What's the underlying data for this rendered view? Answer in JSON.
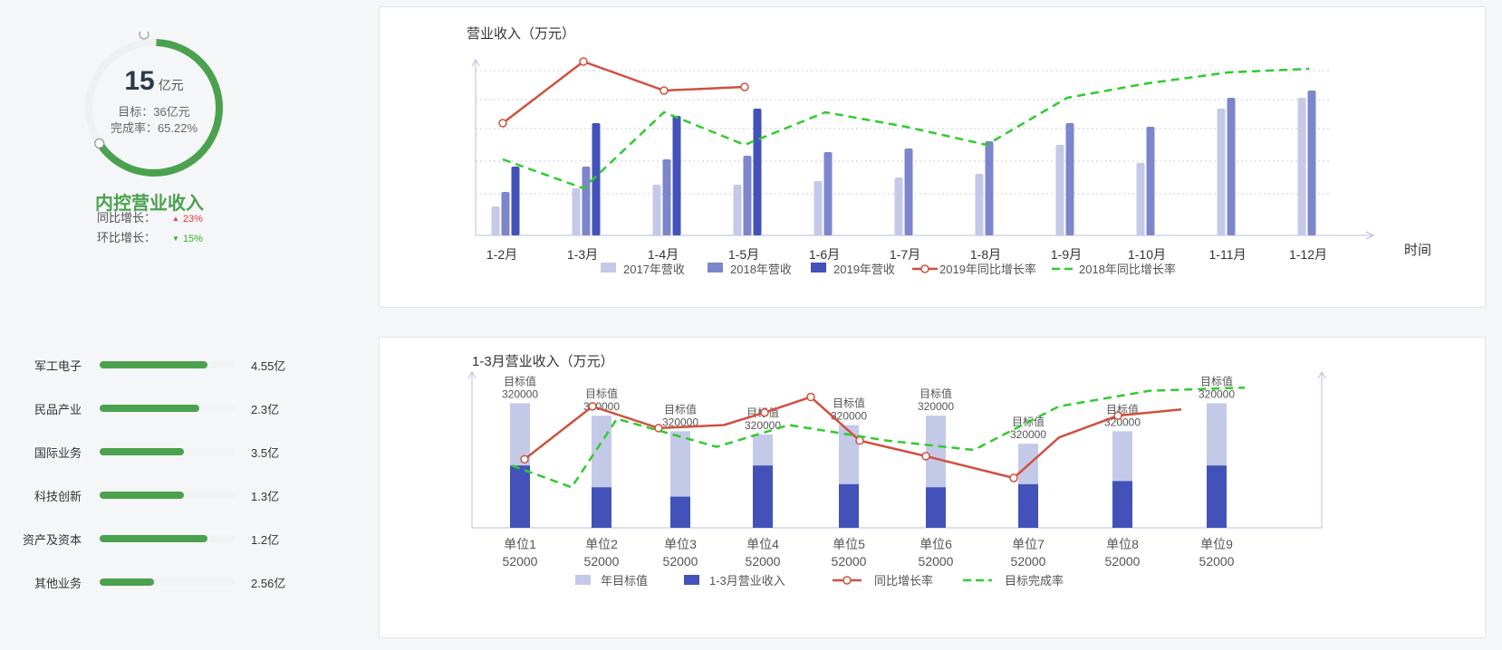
{
  "summary": {
    "value": "15",
    "unit": "亿元",
    "target_text": "目标：36亿元",
    "rate_text": "完成率：65.22%",
    "completion": 0.6522,
    "title": "内控营业收入",
    "yoy_label": "同比增长：",
    "yoy_value": "23%",
    "mom_label": "环比增长：",
    "mom_value": "15%",
    "colors": {
      "accent": "#4aa24e",
      "up": "#e03b3b",
      "down": "#2ab52a"
    }
  },
  "business_bars": [
    {
      "label": "军工电子",
      "value": "4.55亿",
      "fraction": 0.79
    },
    {
      "label": "民品产业",
      "value": "2.3亿",
      "fraction": 0.73
    },
    {
      "label": "国际业务",
      "value": "3.5亿",
      "fraction": 0.62
    },
    {
      "label": "科技创新",
      "value": "1.3亿",
      "fraction": 0.62
    },
    {
      "label": "资产及资本",
      "value": "1.2亿",
      "fraction": 0.79
    },
    {
      "label": "其他业务",
      "value": "2.56亿",
      "fraction": 0.4
    }
  ],
  "chart_data": [
    {
      "type": "bar",
      "title": "营业收入（万元）",
      "xlabel": "时间",
      "categories": [
        "1-2月",
        "1-3月",
        "1-4月",
        "1-5月",
        "1-6月",
        "1-7月",
        "1-8月",
        "1-9月",
        "1-10月",
        "1-11月",
        "1-12月"
      ],
      "ylim": [
        0,
        4.8
      ],
      "grid": "dotted horizontal",
      "legend_position": "bottom",
      "series": [
        {
          "name": "2017年营收",
          "kind": "bar",
          "color": "#c5c9e8",
          "values": [
            0.8,
            1.3,
            1.4,
            1.4,
            1.5,
            1.6,
            1.7,
            2.5,
            2.0,
            3.5,
            3.8
          ]
        },
        {
          "name": "2018年营收",
          "kind": "bar",
          "color": "#7c86cc",
          "values": [
            1.2,
            1.9,
            2.1,
            2.2,
            2.3,
            2.4,
            2.6,
            3.1,
            3.0,
            3.8,
            4.0
          ]
        },
        {
          "name": "2019年营收",
          "kind": "bar",
          "color": "#4352b8",
          "values": [
            1.9,
            3.1,
            3.3,
            3.5,
            null,
            null,
            null,
            null,
            null,
            null,
            null
          ]
        },
        {
          "name": "2019年同比增长率",
          "kind": "line",
          "color": "#d0503f",
          "values": [
            3.1,
            4.8,
            4.0,
            4.1,
            null,
            null,
            null,
            null,
            null,
            null,
            null
          ]
        },
        {
          "name": "2018年同比增长率",
          "kind": "dashed-line",
          "color": "#2ecc2e",
          "values": [
            2.1,
            1.3,
            3.4,
            2.5,
            3.4,
            3.0,
            2.5,
            3.8,
            4.2,
            4.5,
            4.6
          ]
        }
      ],
      "x_points": [
        0.5,
        1.4,
        2.5,
        3.3,
        4.5,
        5.6,
        6.5,
        7.5,
        8.6,
        9.5,
        10.5
      ]
    },
    {
      "type": "bar",
      "title": "1-3月营业收入（万元）",
      "categories": [
        "单位1",
        "单位2",
        "单位3",
        "单位4",
        "单位5",
        "单位6",
        "单位7",
        "单位8",
        "单位9"
      ],
      "category_values": [
        "52000",
        "52000",
        "52000",
        "52000",
        "52000",
        "52000",
        "52000",
        "52000",
        "52000"
      ],
      "target_label": "目标值",
      "target_value_text": "320000",
      "ylim": [
        0,
        5
      ],
      "legend_position": "bottom",
      "series": [
        {
          "name": "年目标值",
          "kind": "bar",
          "color": "#c5c9e8",
          "values": [
            4.0,
            3.6,
            3.1,
            3.0,
            3.3,
            3.6,
            2.7,
            3.1,
            4.0
          ]
        },
        {
          "name": "1-3月营业收入",
          "kind": "bar",
          "color": "#4352b8",
          "values": [
            2.0,
            1.3,
            1.0,
            2.0,
            1.4,
            1.3,
            1.4,
            1.5,
            2.0
          ]
        },
        {
          "name": "同比增长率",
          "kind": "line",
          "color": "#d0503f",
          "values": [
            2.2,
            3.9,
            3.2,
            4.2,
            2.8,
            2.3,
            1.6,
            3.6,
            3.8
          ]
        },
        {
          "name": "目标完成率",
          "kind": "dashed-line",
          "color": "#2ecc2e",
          "values": [
            2.0,
            1.3,
            3.5,
            2.6,
            3.3,
            2.6,
            2.4,
            3.9,
            4.4
          ]
        }
      ]
    }
  ]
}
